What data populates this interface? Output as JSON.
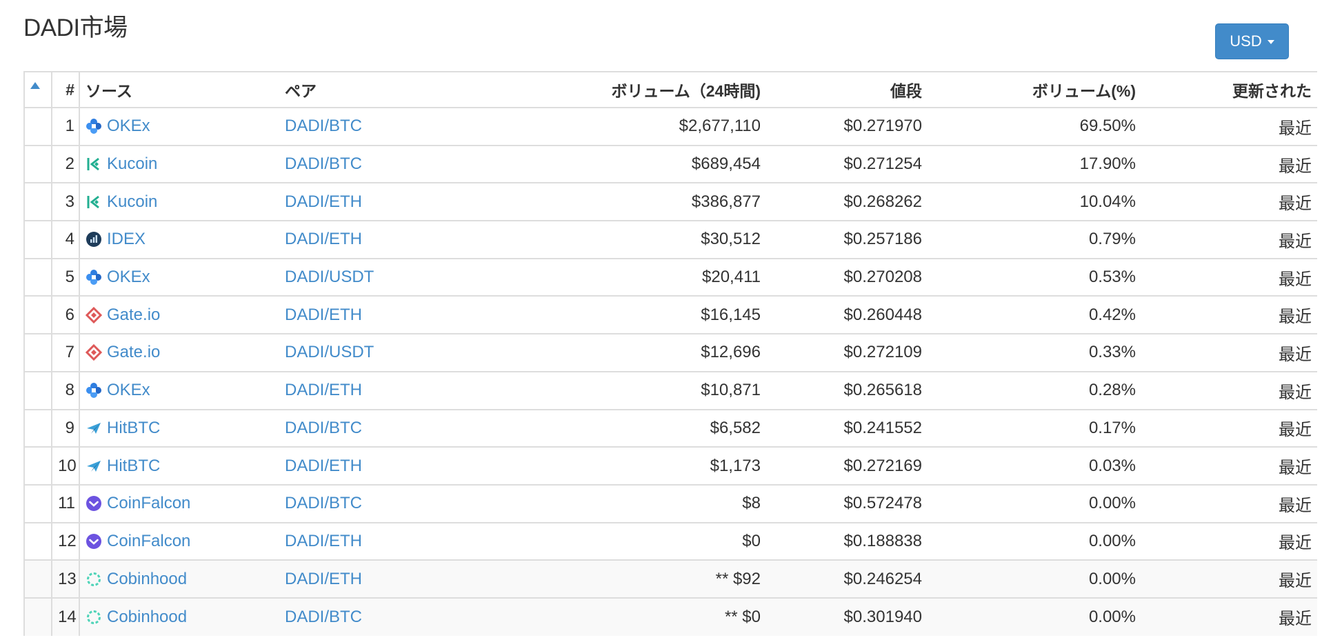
{
  "page": {
    "title": "DADI市場"
  },
  "currency": {
    "label": "USD"
  },
  "table": {
    "headers": {
      "num": "#",
      "source": "ソース",
      "pair": "ペア",
      "volume": "ボリューム（24時間)",
      "price": "値段",
      "volume_pct": "ボリューム(%)",
      "updated": "更新された"
    },
    "rows": [
      {
        "num": "1",
        "source": "OKEx",
        "icon": "okex-icon",
        "pair": "DADI/BTC",
        "volume": "$2,677,110",
        "price": "$0.271970",
        "pct": "69.50%",
        "updated": "最近"
      },
      {
        "num": "2",
        "source": "Kucoin",
        "icon": "kucoin-icon",
        "pair": "DADI/BTC",
        "volume": "$689,454",
        "price": "$0.271254",
        "pct": "17.90%",
        "updated": "最近"
      },
      {
        "num": "3",
        "source": "Kucoin",
        "icon": "kucoin-icon",
        "pair": "DADI/ETH",
        "volume": "$386,877",
        "price": "$0.268262",
        "pct": "10.04%",
        "updated": "最近"
      },
      {
        "num": "4",
        "source": "IDEX",
        "icon": "idex-icon",
        "pair": "DADI/ETH",
        "volume": "$30,512",
        "price": "$0.257186",
        "pct": "0.79%",
        "updated": "最近"
      },
      {
        "num": "5",
        "source": "OKEx",
        "icon": "okex-icon",
        "pair": "DADI/USDT",
        "volume": "$20,411",
        "price": "$0.270208",
        "pct": "0.53%",
        "updated": "最近"
      },
      {
        "num": "6",
        "source": "Gate.io",
        "icon": "gateio-icon",
        "pair": "DADI/ETH",
        "volume": "$16,145",
        "price": "$0.260448",
        "pct": "0.42%",
        "updated": "最近"
      },
      {
        "num": "7",
        "source": "Gate.io",
        "icon": "gateio-icon",
        "pair": "DADI/USDT",
        "volume": "$12,696",
        "price": "$0.272109",
        "pct": "0.33%",
        "updated": "最近"
      },
      {
        "num": "8",
        "source": "OKEx",
        "icon": "okex-icon",
        "pair": "DADI/ETH",
        "volume": "$10,871",
        "price": "$0.265618",
        "pct": "0.28%",
        "updated": "最近"
      },
      {
        "num": "9",
        "source": "HitBTC",
        "icon": "hitbtc-icon",
        "pair": "DADI/BTC",
        "volume": "$6,582",
        "price": "$0.241552",
        "pct": "0.17%",
        "updated": "最近"
      },
      {
        "num": "10",
        "source": "HitBTC",
        "icon": "hitbtc-icon",
        "pair": "DADI/ETH",
        "volume": "$1,173",
        "price": "$0.272169",
        "pct": "0.03%",
        "updated": "最近"
      },
      {
        "num": "11",
        "source": "CoinFalcon",
        "icon": "coinfalcon-icon",
        "pair": "DADI/BTC",
        "volume": "$8",
        "price": "$0.572478",
        "pct": "0.00%",
        "updated": "最近"
      },
      {
        "num": "12",
        "source": "CoinFalcon",
        "icon": "coinfalcon-icon",
        "pair": "DADI/ETH",
        "volume": "$0",
        "price": "$0.188838",
        "pct": "0.00%",
        "updated": "最近"
      },
      {
        "num": "13",
        "source": "Cobinhood",
        "icon": "cobinhood-icon",
        "pair": "DADI/ETH",
        "volume": "** $92",
        "price": "$0.246254",
        "pct": "0.00%",
        "updated": "最近"
      },
      {
        "num": "14",
        "source": "Cobinhood",
        "icon": "cobinhood-icon",
        "pair": "DADI/BTC",
        "volume": "** $0",
        "price": "$0.301940",
        "pct": "0.00%",
        "updated": "最近"
      }
    ]
  },
  "colors": {
    "link": "#428bca",
    "button_bg": "#428bca",
    "okex": "#2f7ee0",
    "kucoin": "#23af91",
    "idex": "#1e3c5a",
    "gateio": "#de5959",
    "hitbtc": "#3aa0d8",
    "coinfalcon": "#6c53e0",
    "cobinhood": "#4fd4b8"
  }
}
